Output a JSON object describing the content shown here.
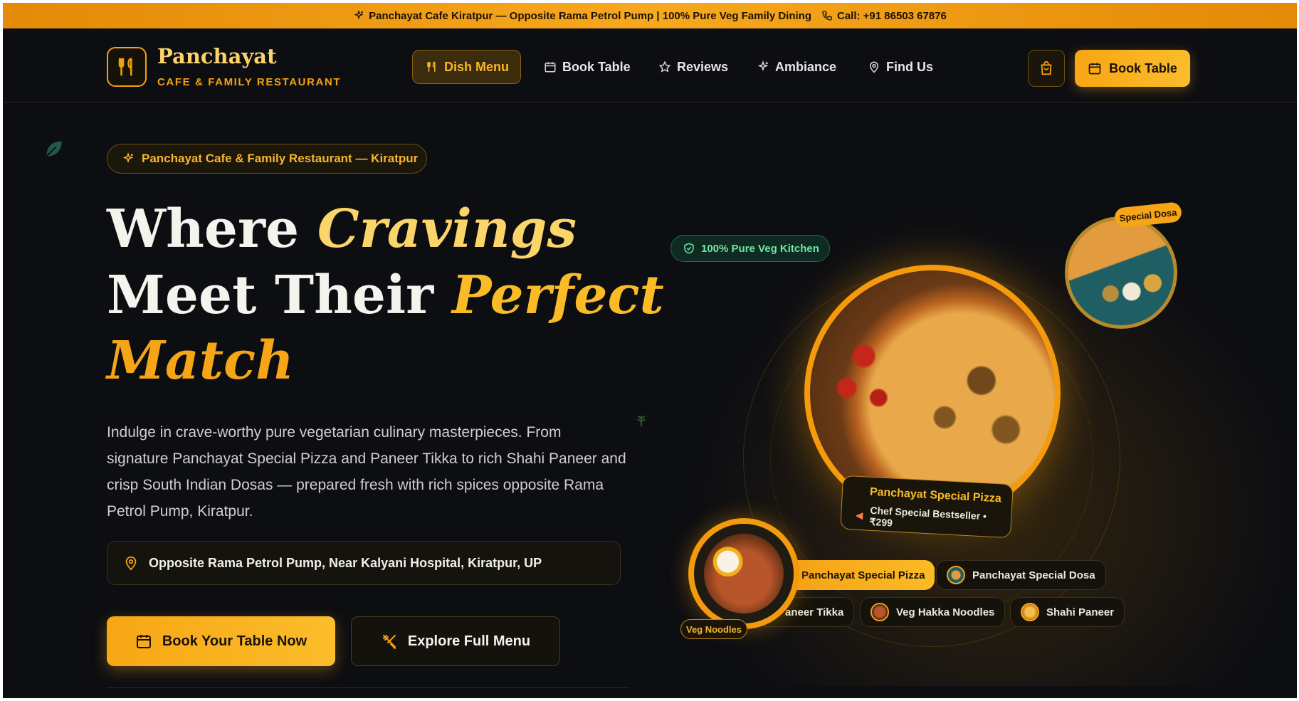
{
  "topbar": {
    "announcement": "Panchayat Cafe Kiratpur — Opposite Rama Petrol Pump | 100% Pure Veg Family Dining",
    "call": "Call: +91 86503 67876"
  },
  "brand": {
    "name": "Panchayat",
    "subtitle": "CAFE & FAMILY RESTAURANT"
  },
  "nav": {
    "items": [
      {
        "label": "Dish Menu",
        "icon": "utensils-icon"
      },
      {
        "label": "Book Table",
        "icon": "calendar-icon"
      },
      {
        "label": "Reviews",
        "icon": "star-icon"
      },
      {
        "label": "Ambiance",
        "icon": "sparkles-icon"
      },
      {
        "label": "Find Us",
        "icon": "map-pin-icon"
      }
    ],
    "cta": "Book Table"
  },
  "hero": {
    "pill": "Panchayat Cafe & Family Restaurant — Kiratpur",
    "headline": {
      "line1_plain": "Where ",
      "line1_accent": "Cravings",
      "line2_plain": "Meet Their ",
      "line2_accent": "Perfect",
      "line3_accent": "Match"
    },
    "description": "Indulge in crave-worthy pure vegetarian culinary masterpieces. From signature Panchayat Special Pizza and Paneer Tikka to rich Shahi Paneer and crisp South Indian Dosas — prepared fresh with rich spices opposite Rama Petrol Pump, Kiratpur.",
    "address": "Opposite Rama Petrol Pump, Near Kalyani Hospital, Kiratpur, UP",
    "cta_primary": "Book Your Table Now",
    "cta_secondary": "Explore Full Menu"
  },
  "showcase": {
    "veg_badge": "100% Pure Veg Kitchen",
    "featured_title": "Panchayat Special Pizza",
    "featured_sub": "Chef Special Bestseller • ₹299",
    "dosa_tag": "Special Dosa",
    "noodles_tag": "Veg Noodles",
    "chips": [
      {
        "label": "Panchayat Special Pizza",
        "active": true
      },
      {
        "label": "Panchayat Special Dosa",
        "active": false
      },
      {
        "label": "aneer Tikka",
        "active": false
      },
      {
        "label": "Veg Hakka Noodles",
        "active": false
      },
      {
        "label": "Shahi Paneer",
        "active": false
      }
    ]
  },
  "colors": {
    "accent": "#f6a516",
    "background": "#0d0e12",
    "veg_green": "#6ee7a8"
  }
}
